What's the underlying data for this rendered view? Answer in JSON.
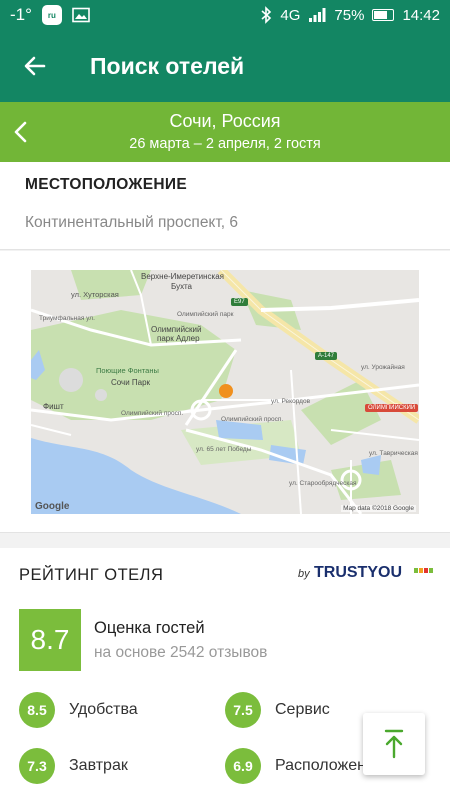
{
  "status_bar": {
    "temperature": "-1°",
    "battery": "75%",
    "battery_level": 0.75,
    "network": "4G",
    "time": "14:42"
  },
  "app_bar": {
    "title": "Поиск отелей"
  },
  "search_summary": {
    "city": "Сочи, Россия",
    "dates_guests": "26 марта – 2 апреля, 2 гостя"
  },
  "location": {
    "heading": "МЕСТОПОЛОЖЕНИЕ",
    "address": "Континентальный проспект, 6"
  },
  "map": {
    "labels": {
      "upper_imeretin_bay": "Верхне-Имеретинская",
      "bay": "Бухта",
      "olympic_park_line1": "Олимпийский",
      "olympic_park_line2": "парк Адлер",
      "olympic_park_station": "Олимпийский парк",
      "singing_fountains": "Поющие Фонтаны",
      "sochi_park": "Сочи Парк",
      "fisht": "Фишт",
      "triumfalnaya": "Триумфальная ул.",
      "khutorskaya": "ул. Хуторская",
      "olimpiyskiy_prosp": "Олимпийский просп.",
      "olimpiyskiy_prosp_2": "Олимпийский просп.",
      "65_let_pobedy": "ул. 65 лет Победы",
      "ul_rekordov": "ул. Рекордов",
      "ul_urozhaynaya": "ул. Урожайная",
      "ul_tavricheskaya": "ул. Таврическая",
      "staroobryadcheskaya": "ул. Старообрядческая",
      "olimpiyskiy_station": "ОЛИМПИЙСКИЙ",
      "e97": "E97",
      "a147": "A-147",
      "google": "Google",
      "map_data": "Map data ©2018 Google"
    },
    "colors": {
      "land": "#e8e6e3",
      "water": "#a9cbf2",
      "park": "#c8e0b0",
      "road": "#ffffff",
      "marker": "#f0901e"
    }
  },
  "rating": {
    "heading": "РЕЙТИНГ ОТЕЛЯ",
    "by": "by",
    "brand": "TRUSTYOU",
    "score": "8.7",
    "score_label": "Оценка гостей",
    "reviews": "на основе 2542 отзывов",
    "subscores": [
      {
        "value": "8.5",
        "label": "Удобства"
      },
      {
        "value": "7.5",
        "label": "Сервис"
      },
      {
        "value": "7.3",
        "label": "Завтрак"
      },
      {
        "value": "6.9",
        "label": "Расположение"
      }
    ],
    "accent": "#7bbd3c"
  },
  "colors": {
    "primary": "#138663",
    "secondary": "#72b637"
  }
}
